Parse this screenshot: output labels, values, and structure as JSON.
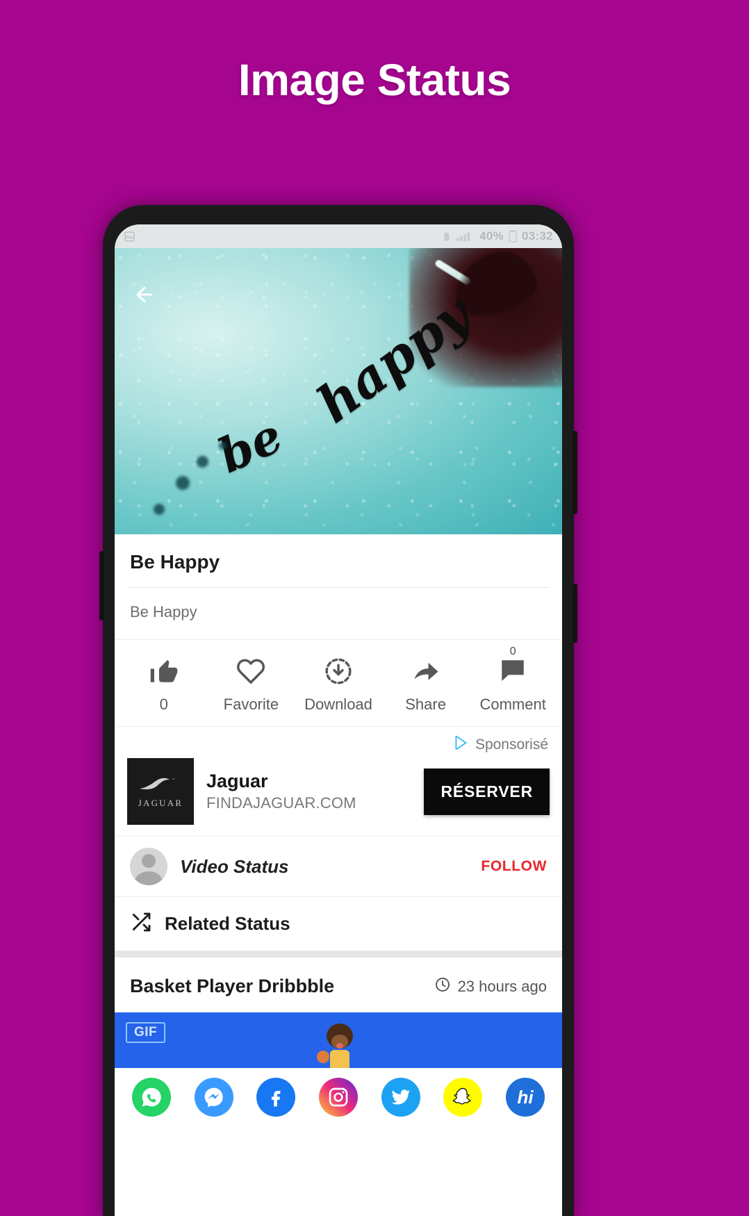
{
  "header": {
    "title": "Image Status"
  },
  "statusbar": {
    "battery_percent": "40%",
    "time": "03:32",
    "icons": [
      "image-icon",
      "sim-icon",
      "signal-icon",
      "battery-icon"
    ]
  },
  "hero": {
    "script_line1": "happy",
    "script_line2": "be",
    "back_icon": "back-arrow-icon"
  },
  "detail": {
    "title": "Be Happy",
    "description": "Be Happy"
  },
  "actions": [
    {
      "icon": "thumbs-up-icon",
      "label": "0"
    },
    {
      "icon": "heart-icon",
      "label": "Favorite"
    },
    {
      "icon": "download-circle-icon",
      "label": "Download"
    },
    {
      "icon": "share-arrow-icon",
      "label": "Share"
    },
    {
      "icon": "comment-bubble-icon",
      "label": "Comment",
      "badge": "0"
    }
  ],
  "ad": {
    "sponsored_label": "Sponsorisé",
    "adchoices_icon": "adchoices-icon",
    "advertiser": "Jaguar",
    "logo_word": "JAGUAR",
    "url": "FINDAJAGUAR.COM",
    "cta": "RÉSERVER"
  },
  "channel": {
    "name": "Video Status",
    "follow_label": "FOLLOW",
    "avatar_icon": "avatar-icon"
  },
  "related": {
    "icon": "shuffle-icon",
    "label": "Related Status",
    "item_title": "Basket Player Dribbble",
    "clock_icon": "clock-icon",
    "item_time": "23 hours ago",
    "gif_badge": "GIF"
  },
  "social": [
    {
      "name": "whatsapp",
      "glyph": "✆",
      "color": "#25D366"
    },
    {
      "name": "messenger",
      "glyph": "⚡",
      "color": "#3A9BFF"
    },
    {
      "name": "facebook",
      "glyph": "f",
      "color": "#1877F2"
    },
    {
      "name": "instagram",
      "glyph": "◎",
      "color": "#C13584"
    },
    {
      "name": "twitter",
      "glyph": "t",
      "color": "#1DA1F2"
    },
    {
      "name": "snapchat",
      "glyph": "☻",
      "color": "#FFFC00"
    },
    {
      "name": "hike",
      "glyph": "hi",
      "color": "#1E6FD9"
    }
  ],
  "colors": {
    "page_bg": "#A5058F",
    "accent_red": "#E8262D",
    "gif_blue": "#2563EB"
  }
}
